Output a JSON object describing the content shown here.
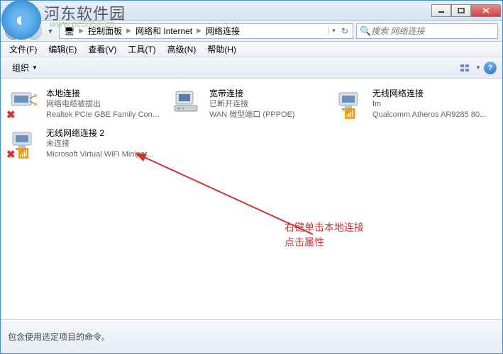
{
  "watermark": {
    "title": "河东软件园",
    "url": "www.pc0359.cn"
  },
  "breadcrumb": {
    "seg1": "控制面板",
    "seg2": "网络和 Internet",
    "seg3": "网络连接"
  },
  "search": {
    "placeholder": "搜索 网络连接"
  },
  "menu": {
    "file": "文件(F)",
    "edit": "编辑(E)",
    "view": "查看(V)",
    "tools": "工具(T)",
    "advanced": "高级(N)",
    "help": "帮助(H)"
  },
  "toolbar": {
    "organize": "组织"
  },
  "connections": [
    {
      "name": "本地连接",
      "status": "网络电缆被拔出",
      "device": "Realtek PCIe GBE Family Contr...",
      "icon": "ethernet",
      "error": true
    },
    {
      "name": "宽带连接",
      "status": "已断开连接",
      "device": "WAN 微型端口 (PPPOE)",
      "icon": "modem",
      "error": false
    },
    {
      "name": "无线网络连接",
      "status": "fm",
      "device": "Qualcomm Atheros AR9285 80...",
      "icon": "wifi",
      "error": false,
      "signal": true
    },
    {
      "name": "无线网络连接 2",
      "status": "未连接",
      "device": "Microsoft Virtual WiFi Minipor...",
      "icon": "wifi",
      "error": true,
      "signal": true
    }
  ],
  "annotation": {
    "line1": "右键单击本地连接",
    "line2": "点击属性"
  },
  "statusbar": {
    "text": "包含使用选定项目的命令。"
  }
}
